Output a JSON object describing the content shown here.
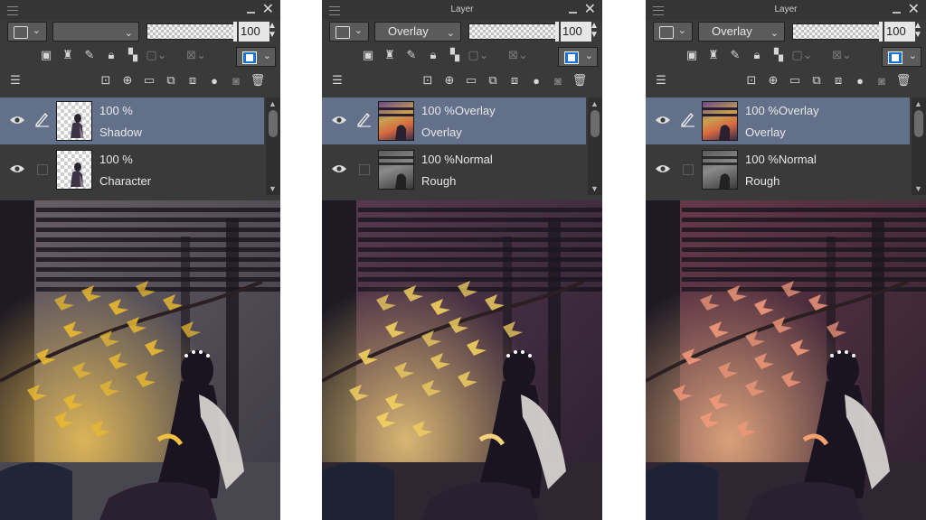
{
  "panels": [
    {
      "title": "",
      "blend_mode": "",
      "opacity": "100",
      "layers": [
        {
          "line1": "100 %",
          "line2": "Shadow",
          "selected": true,
          "thumb": "transparent-figure"
        },
        {
          "line1": "100 %",
          "line2": "Character",
          "selected": false,
          "thumb": "transparent-figure"
        }
      ],
      "canvas_tint": "yellow"
    },
    {
      "title": "Layer",
      "blend_mode": "Overlay",
      "opacity": "100",
      "layers": [
        {
          "line1": "100 %Overlay",
          "line2": "Overlay",
          "selected": true,
          "thumb": "color-painting"
        },
        {
          "line1": "100 %Normal",
          "line2": "Rough",
          "selected": false,
          "thumb": "gray-painting"
        }
      ],
      "canvas_tint": "purple"
    },
    {
      "title": "Layer",
      "blend_mode": "Overlay",
      "opacity": "100",
      "layers": [
        {
          "line1": "100 %Overlay",
          "line2": "Overlay",
          "selected": true,
          "thumb": "color-painting"
        },
        {
          "line1": "100 %Normal",
          "line2": "Rough",
          "selected": false,
          "thumb": "gray-painting"
        }
      ],
      "canvas_tint": "pink"
    }
  ],
  "icons": {
    "row2": [
      "layer-mask-icon",
      "reference-layer-icon",
      "draft-layer-icon",
      "lock-icon",
      "lock-transparent-icon",
      "clip-icon",
      "mask-enable-icon",
      "ruler-icon",
      "layer-color-icon"
    ],
    "row3": [
      "panel-menu-icon",
      "new-raster-layer-icon",
      "new-vector-layer-icon",
      "new-folder-icon",
      "copy-layer-icon",
      "merge-down-icon",
      "mask-icon",
      "camera-icon",
      "trash-icon"
    ]
  },
  "colors": {
    "panel_bg": "#3a3a3a",
    "selected_row": "#63708a",
    "accent_blue": "#1a6fd6"
  }
}
